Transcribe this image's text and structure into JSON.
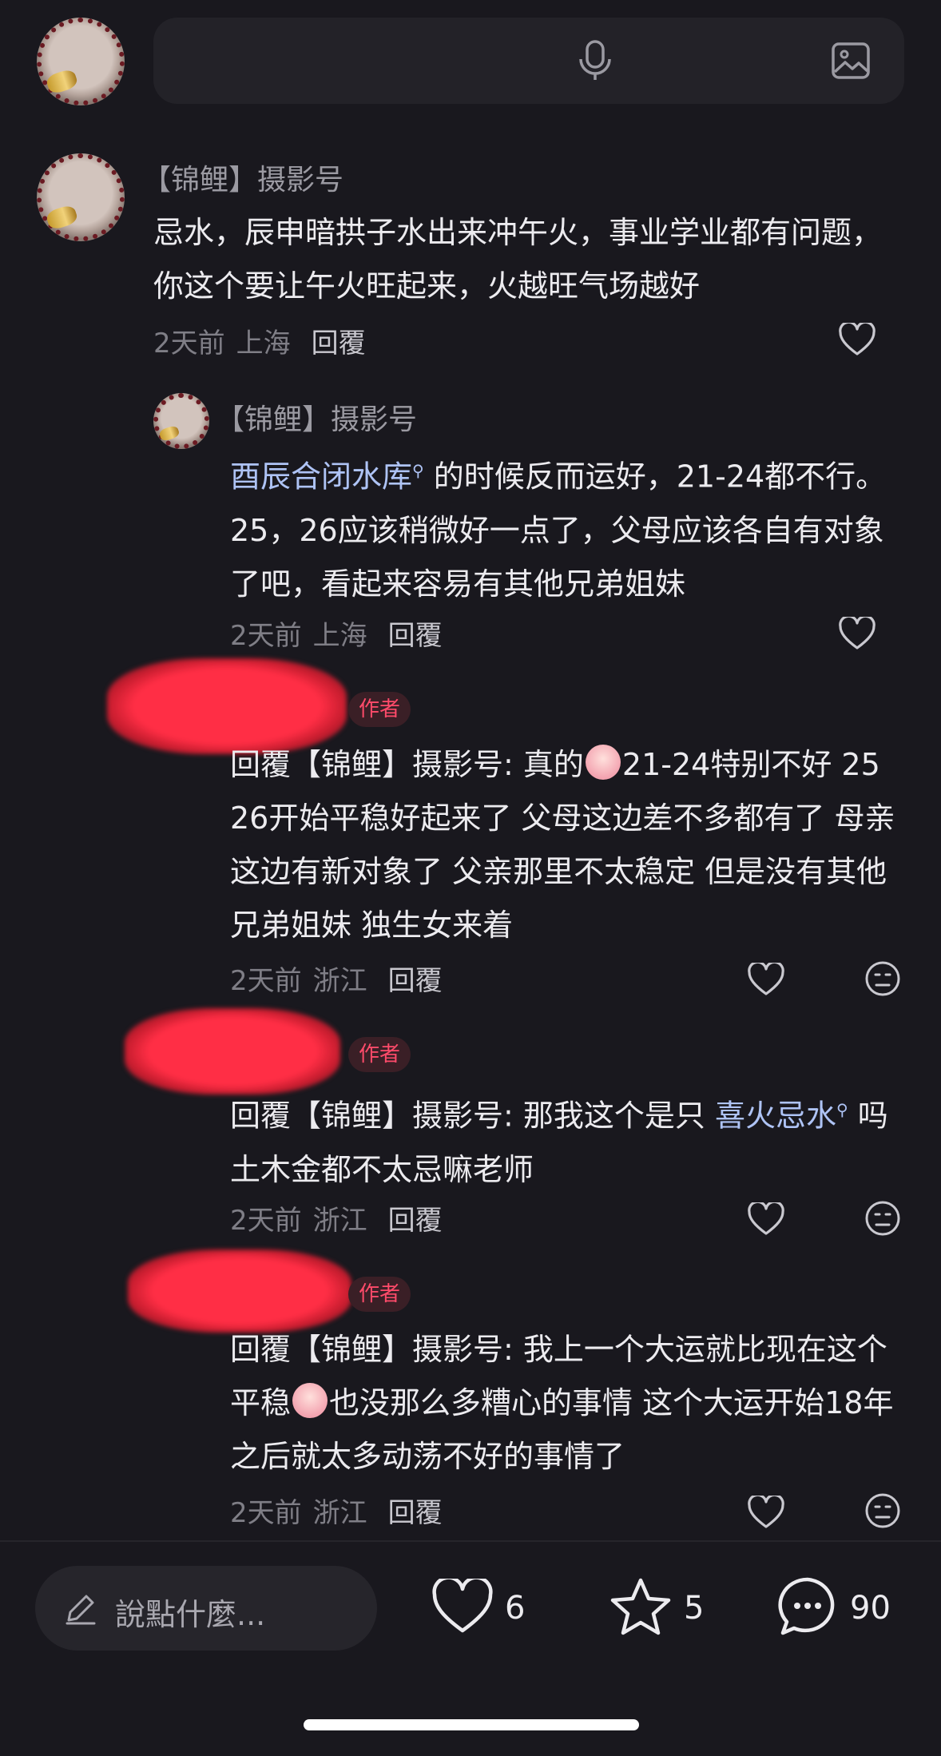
{
  "top_input": {
    "placeholder": ""
  },
  "comments": [
    {
      "username": "【锦鲤】摄影号",
      "body": "忌水，辰申暗拱子水出来冲午火，事业学业都有问题，你这个要让午火旺起来，火越旺气场越好",
      "time": "2天前",
      "location": "上海",
      "reply": "回覆"
    },
    {
      "username": "【锦鲤】摄影号",
      "link_text": "酉辰合闭水库",
      "body_after": " 的时候反而运好，21-24都不行。25，26应该稍微好一点了，父母应该各自有对象了吧，看起来容易有其他兄弟姐妹",
      "time": "2天前",
      "location": "上海",
      "reply": "回覆"
    },
    {
      "badge": "作者",
      "reply_prefix": "回覆【锦鲤】摄影号: ",
      "body_a": "真的",
      "body_b": "21-24特别不好 25 26开始平稳好起来了 父母这边差不多都有了 母亲这边有新对象了 父亲那里不太稳定 但是没有其他兄弟姐妹 独生女来着",
      "time": "2天前",
      "location": "浙江",
      "reply": "回覆"
    },
    {
      "badge": "作者",
      "reply_prefix": "回覆【锦鲤】摄影号: ",
      "body_a": "那我这个是只 ",
      "link_text": "喜火忌水",
      "body_b": " 吗 土木金都不太忌嘛老师",
      "time": "2天前",
      "location": "浙江",
      "reply": "回覆"
    },
    {
      "badge": "作者",
      "reply_prefix": "回覆【锦鲤】摄影号: ",
      "body_a": "我上一个大运就比现在这个平稳",
      "body_b": "也没那么多糟心的事情 这个大运开始18年之后就太多动荡不好的事情了",
      "time": "2天前",
      "location": "浙江",
      "reply": "回覆"
    }
  ],
  "bottom_bar": {
    "say_placeholder": "說點什麼...",
    "likes": "6",
    "stars": "5",
    "comments": "90"
  },
  "colors": {
    "background": "#19181e",
    "link": "#aec3f5",
    "author_badge": "#ff4b6a"
  },
  "icons": [
    "mic-icon",
    "image-icon",
    "heart-icon",
    "sad-face-icon",
    "pen-icon",
    "star-icon",
    "chat-icon"
  ]
}
